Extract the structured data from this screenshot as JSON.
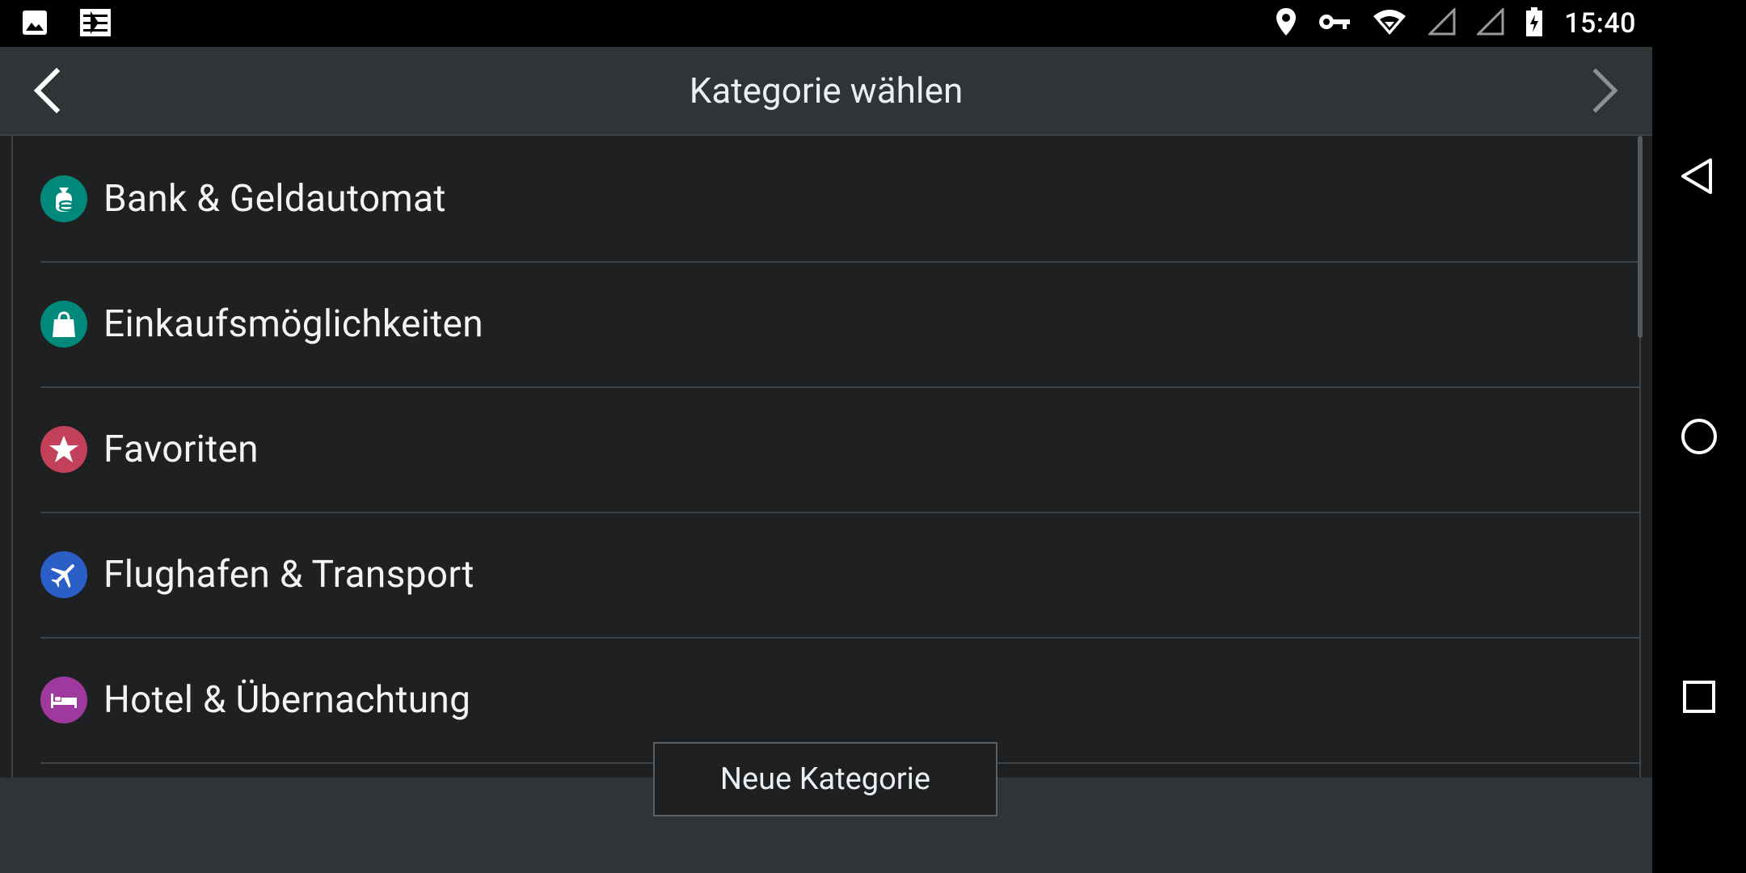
{
  "status_bar": {
    "time": "15:40",
    "left_icons": [
      "image-icon",
      "sliders-icon"
    ],
    "right_icons": [
      "location-icon",
      "key-icon",
      "wifi-icon",
      "signal-icon",
      "signal-icon",
      "battery-icon"
    ]
  },
  "toolbar": {
    "title": "Kategorie wählen",
    "back_icon": "chevron-left-icon",
    "forward_icon": "chevron-right-icon"
  },
  "categories": [
    {
      "label": "Bank & Geldautomat",
      "icon": "money-bag-icon",
      "color": "#00897b"
    },
    {
      "label": "Einkaufsmöglichkeiten",
      "icon": "shopping-bag-icon",
      "color": "#00897b"
    },
    {
      "label": "Favoriten",
      "icon": "star-icon",
      "color": "#c2405a"
    },
    {
      "label": "Flughafen & Transport",
      "icon": "airplane-icon",
      "color": "#2a5fc7"
    },
    {
      "label": "Hotel & Übernachtung",
      "icon": "bed-icon",
      "color": "#a0399f"
    }
  ],
  "footer": {
    "new_category_label": "Neue Kategorie"
  },
  "nav_bar": {
    "icons": [
      "back-triangle-icon",
      "home-circle-icon",
      "recents-square-icon"
    ]
  }
}
